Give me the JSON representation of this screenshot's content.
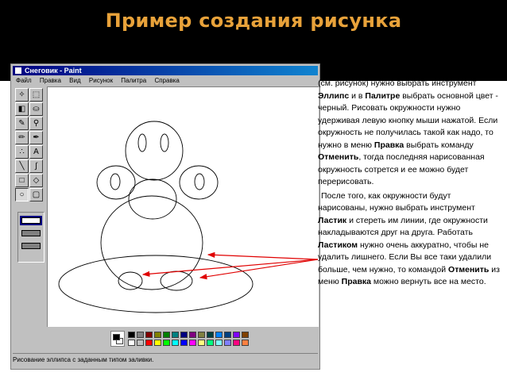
{
  "slide": {
    "title": "Пример создания рисунка"
  },
  "paint": {
    "window_title": "Снеговик - Paint",
    "menu": [
      "Файл",
      "Правка",
      "Вид",
      "Рисунок",
      "Палитра",
      "Справка"
    ],
    "status": "Рисование эллипса с заданным типом заливки.",
    "tools": [
      {
        "name": "free-select-tool",
        "glyph": "✧"
      },
      {
        "name": "select-tool",
        "glyph": "⬚"
      },
      {
        "name": "eraser-tool",
        "glyph": "◧"
      },
      {
        "name": "fill-tool",
        "glyph": "⛀"
      },
      {
        "name": "color-picker-tool",
        "glyph": "✎"
      },
      {
        "name": "magnifier-tool",
        "glyph": "⚲"
      },
      {
        "name": "pencil-tool",
        "glyph": "✏"
      },
      {
        "name": "brush-tool",
        "glyph": "✒"
      },
      {
        "name": "airbrush-tool",
        "glyph": "∴"
      },
      {
        "name": "text-tool",
        "glyph": "A"
      },
      {
        "name": "line-tool",
        "glyph": "╲"
      },
      {
        "name": "curve-tool",
        "glyph": "∫"
      },
      {
        "name": "rectangle-tool",
        "glyph": "□"
      },
      {
        "name": "polygon-tool",
        "glyph": "◇"
      },
      {
        "name": "ellipse-tool",
        "glyph": "○"
      },
      {
        "name": "rounded-rect-tool",
        "glyph": "▢"
      }
    ],
    "palette_top": [
      "#000000",
      "#808080",
      "#800000",
      "#808000",
      "#008000",
      "#008080",
      "#000080",
      "#800080",
      "#808040",
      "#004040",
      "#0080ff",
      "#004080",
      "#8000ff",
      "#804000"
    ],
    "palette_bottom": [
      "#ffffff",
      "#c0c0c0",
      "#ff0000",
      "#ffff00",
      "#00ff00",
      "#00ffff",
      "#0000ff",
      "#ff00ff",
      "#ffff80",
      "#00ff80",
      "#80ffff",
      "#8080ff",
      "#ff0080",
      "#ff8040"
    ],
    "arrow_color": "#e00000"
  },
  "explanation": {
    "p1": [
      {
        "t": "(см. рисунок) нужно выбрать инструмент "
      },
      {
        "t": "Эллипс",
        "b": true
      },
      {
        "t": " и в "
      },
      {
        "t": "Палитре",
        "b": true
      },
      {
        "t": " выбрать основной цвет - черный. Рисовать окружности нужно удерживая левую кнопку мыши нажатой. Если окружность не получилась такой как надо, то нужно в меню "
      },
      {
        "t": "Правка",
        "b": true
      },
      {
        "t": " выбрать команду "
      },
      {
        "t": "Отменить",
        "b": true
      },
      {
        "t": ", тогда последняя нарисованная окружность сотрется и ее можно будет перерисовать."
      }
    ],
    "p2": [
      {
        "t": "После того, как окружности будут нарисованы, нужно выбрать инструмент "
      },
      {
        "t": "Ластик",
        "b": true
      },
      {
        "t": " и стереть им линии, где окружности накладываются друг на друга. Работать "
      },
      {
        "t": "Ластиком",
        "b": true
      },
      {
        "t": " нужно очень аккуратно, чтобы не удалить лишнего. Если Вы все таки удалили больше, чем нужно, то командой "
      },
      {
        "t": "Отменить",
        "b": true
      },
      {
        "t": " из меню "
      },
      {
        "t": "Правка",
        "b": true
      },
      {
        "t": " можно вернуть все на место."
      }
    ]
  }
}
